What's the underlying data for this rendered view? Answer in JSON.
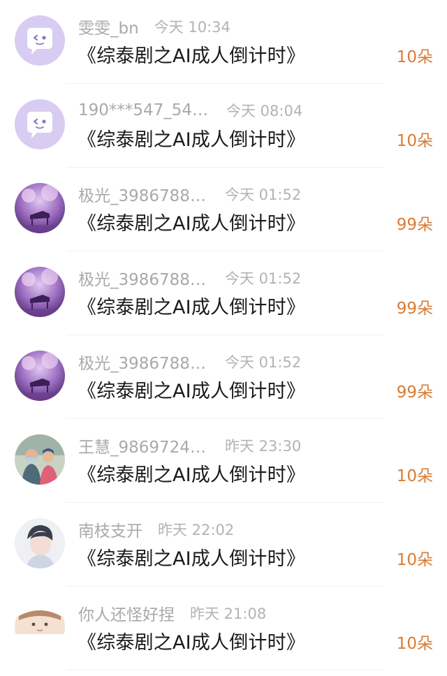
{
  "items": [
    {
      "name": "雯雯_bn",
      "time": "今天 10:34",
      "title": "《综泰剧之AI成人倒计时》",
      "amount": "10朵",
      "avatar": "default-chat-avatar"
    },
    {
      "name": "190***547_543...",
      "time": "今天 08:04",
      "title": "《综泰剧之AI成人倒计时》",
      "amount": "10朵",
      "avatar": "default-chat-avatar"
    },
    {
      "name": "极光_39867886...",
      "time": "今天 01:52",
      "title": "《综泰剧之AI成人倒计时》",
      "amount": "99朵",
      "avatar": "purple-piano-avatar"
    },
    {
      "name": "极光_39867886...",
      "time": "今天 01:52",
      "title": "《综泰剧之AI成人倒计时》",
      "amount": "99朵",
      "avatar": "purple-piano-avatar"
    },
    {
      "name": "极光_39867886...",
      "time": "今天 01:52",
      "title": "《综泰剧之AI成人倒计时》",
      "amount": "99朵",
      "avatar": "purple-piano-avatar"
    },
    {
      "name": "王慧_98697241...",
      "time": "昨天 23:30",
      "title": "《综泰剧之AI成人倒计时》",
      "amount": "10朵",
      "avatar": "family-photo-avatar"
    },
    {
      "name": "南枝支开",
      "time": "昨天 22:02",
      "title": "《综泰剧之AI成人倒计时》",
      "amount": "10朵",
      "avatar": "portrait-avatar"
    },
    {
      "name": "你人还怪好捏",
      "time": "昨天 21:08",
      "title": "《综泰剧之AI成人倒计时》",
      "amount": "10朵",
      "avatar": "cartoon-avatar"
    }
  ],
  "colors": {
    "amount": "#d97b34",
    "meta": "#a9a9a9",
    "title": "#1a1a1a",
    "default_avatar_bg": "#d9ccf3"
  }
}
